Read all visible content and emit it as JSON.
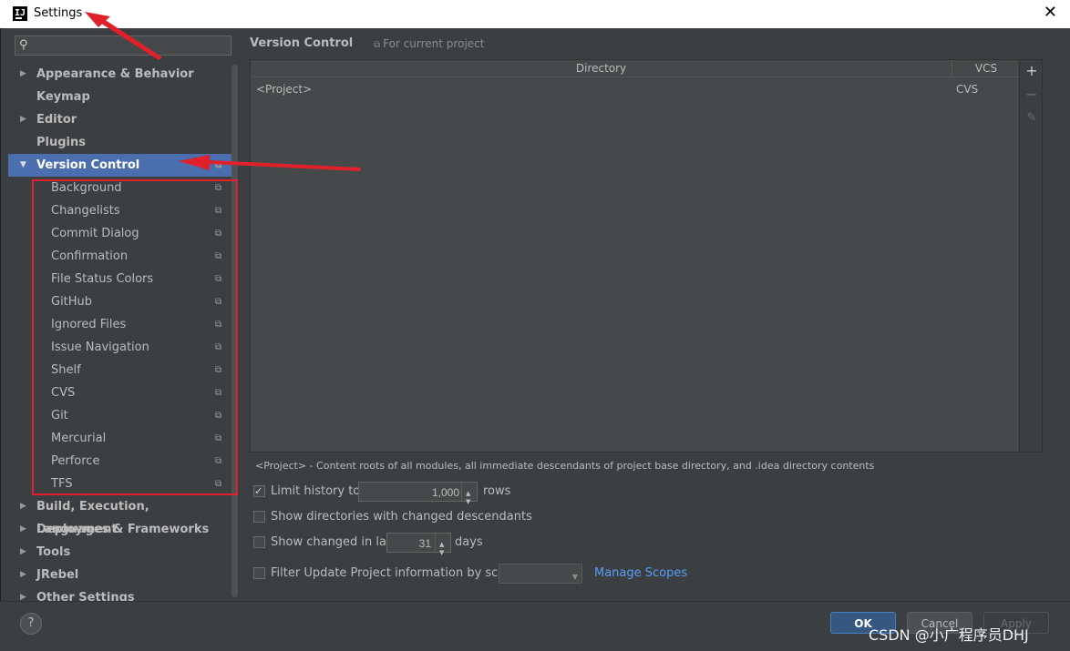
{
  "window": {
    "title": "Settings",
    "close_glyph": "✕"
  },
  "search": {
    "icon": "search-icon",
    "placeholder": ""
  },
  "tree": [
    {
      "label": "Appearance & Behavior",
      "arrow": "▶",
      "level": 0
    },
    {
      "label": "Keymap",
      "arrow": "",
      "level": 0
    },
    {
      "label": "Editor",
      "arrow": "▶",
      "level": 0
    },
    {
      "label": "Plugins",
      "arrow": "",
      "level": 0
    },
    {
      "label": "Version Control",
      "arrow": "▼",
      "level": 0,
      "selected": true
    },
    {
      "label": "Background",
      "level": 1
    },
    {
      "label": "Changelists",
      "level": 1
    },
    {
      "label": "Commit Dialog",
      "level": 1
    },
    {
      "label": "Confirmation",
      "level": 1
    },
    {
      "label": "File Status Colors",
      "level": 1
    },
    {
      "label": "GitHub",
      "level": 1
    },
    {
      "label": "Ignored Files",
      "level": 1
    },
    {
      "label": "Issue Navigation",
      "level": 1
    },
    {
      "label": "Shelf",
      "level": 1
    },
    {
      "label": "CVS",
      "level": 1
    },
    {
      "label": "Git",
      "level": 1
    },
    {
      "label": "Mercurial",
      "level": 1
    },
    {
      "label": "Perforce",
      "level": 1
    },
    {
      "label": "TFS",
      "level": 1
    },
    {
      "label": "Build, Execution, Deployment",
      "arrow": "▶",
      "level": 0
    },
    {
      "label": "Languages & Frameworks",
      "arrow": "▶",
      "level": 0
    },
    {
      "label": "Tools",
      "arrow": "▶",
      "level": 0
    },
    {
      "label": "JRebel",
      "arrow": "▶",
      "level": 0
    },
    {
      "label": "Other Settings",
      "arrow": "▶",
      "level": 0
    }
  ],
  "content": {
    "header": "Version Control",
    "scope_note": "For current project",
    "table": {
      "columns": [
        "Directory",
        "VCS"
      ],
      "rows": [
        {
          "directory": "<Project>",
          "vcs": "CVS"
        }
      ]
    },
    "description": "<Project> - Content roots of all modules, all immediate descendants of project base directory, and .idea directory contents",
    "limit_history": {
      "label": "Limit history to:",
      "value": "1,000",
      "suffix": "rows",
      "checked": true
    },
    "show_dirs": {
      "label": "Show directories with changed descendants",
      "checked": false
    },
    "show_changed": {
      "label": "Show changed in last",
      "value": "31",
      "suffix": "days",
      "checked": false
    },
    "filter_update": {
      "label": "Filter Update Project information by scope",
      "checked": false,
      "select_value": ""
    },
    "manage_scopes": "Manage Scopes"
  },
  "footer": {
    "help": "?",
    "ok": "OK",
    "cancel": "Cancel",
    "apply": "Apply"
  },
  "watermark": "CSDN @小广程序员DHJ",
  "colors": {
    "accent_selected": "#4b6eaf",
    "annotation_red": "#e0212b",
    "link": "#589df6"
  }
}
